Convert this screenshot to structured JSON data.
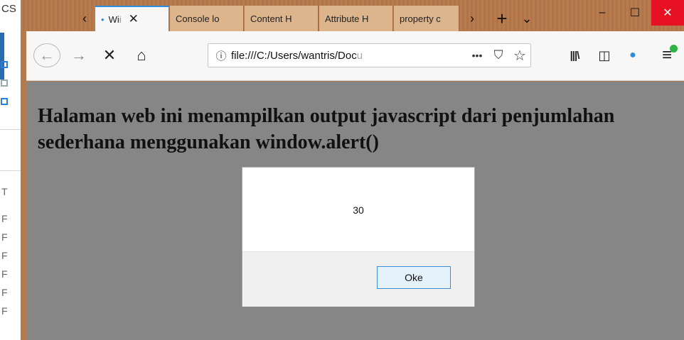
{
  "background_window": {
    "title": "CS",
    "letters": [
      "T",
      "F",
      "F",
      "F",
      "F",
      "F",
      "F"
    ]
  },
  "browser": {
    "tabs": [
      {
        "label_main": "Wi",
        "label_fade": "i",
        "active": true,
        "close": "✕",
        "dot": "•"
      },
      {
        "label_main": "Console lo",
        "label_fade": "",
        "active": false
      },
      {
        "label_main": "Content H",
        "label_fade": "",
        "active": false
      },
      {
        "label_main": "Attribute H",
        "label_fade": "",
        "active": false
      },
      {
        "label_main": "property c",
        "label_fade": "",
        "active": false
      }
    ],
    "tab_scroll_left": "‹",
    "tab_scroll_right": "›",
    "new_tab": "+",
    "all_tabs": "⌄",
    "window_controls": {
      "minimize": "–",
      "maximize": "☐",
      "close": "✕"
    },
    "nav": {
      "back": "←",
      "forward": "→",
      "stop": "✕",
      "home": "⌂",
      "url_main": "file:///C:/Users/wantris/Doc",
      "url_fade": "u",
      "page_actions": "•••",
      "pocket": "⛉",
      "bookmark": "☆",
      "library": "|||\\",
      "sidebar": "◫",
      "extension": "●",
      "menu": "≡"
    },
    "accent_color": "#2a8de0",
    "close_color": "#e81123"
  },
  "page": {
    "heading": "Halaman web ini menampilkan output javascript dari penjumlahan sederhana menggunakan window.alert()"
  },
  "alert": {
    "message": "30",
    "ok_label": "Oke"
  }
}
